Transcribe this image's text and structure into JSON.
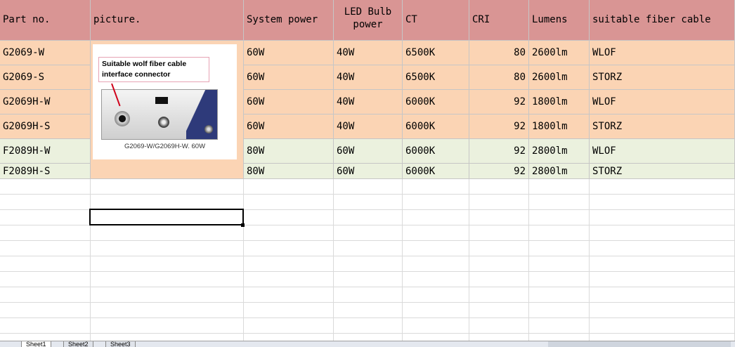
{
  "headers": {
    "part_no": "Part no.",
    "picture": "picture.",
    "system_power": "System power",
    "led_bulb_power": "LED Bulb power",
    "ct": "CT",
    "cri": "CRI",
    "lumens": "Lumens",
    "fiber_cable": "suitable fiber cable"
  },
  "rows": [
    {
      "part": "G2069-W",
      "system_power": "60W",
      "bulb": "40W",
      "ct": "6500K",
      "cri": "80",
      "lumens": "2600lm",
      "cable": "WLOF"
    },
    {
      "part": "G2069-S",
      "system_power": "60W",
      "bulb": "40W",
      "ct": "6500K",
      "cri": "80",
      "lumens": "2600lm",
      "cable": "STORZ"
    },
    {
      "part": "G2069H-W",
      "system_power": "60W",
      "bulb": "40W",
      "ct": "6000K",
      "cri": "92",
      "lumens": "1800lm",
      "cable": "WLOF"
    },
    {
      "part": "G2069H-S",
      "system_power": "60W",
      "bulb": "40W",
      "ct": "6000K",
      "cri": "92",
      "lumens": "1800lm",
      "cable": "STORZ"
    },
    {
      "part": "F2089H-W",
      "system_power": "80W",
      "bulb": "60W",
      "ct": "6000K",
      "cri": "92",
      "lumens": "2800lm",
      "cable": "WLOF"
    },
    {
      "part": "F2089H-S",
      "system_power": "80W",
      "bulb": "60W",
      "ct": "6000K",
      "cri": "92",
      "lumens": "2800lm",
      "cable": "STORZ"
    }
  ],
  "picture": {
    "callout": "Suitable  wolf  fiber cable interface connector",
    "caption": "G2069-W/G2069H-W. 60W"
  },
  "sheet_tabs": [
    "Sheet1",
    "Sheet2",
    "Sheet3"
  ],
  "colors": {
    "header": "#d99594",
    "peach": "#fbd4b4",
    "green": "#ebf1de"
  }
}
